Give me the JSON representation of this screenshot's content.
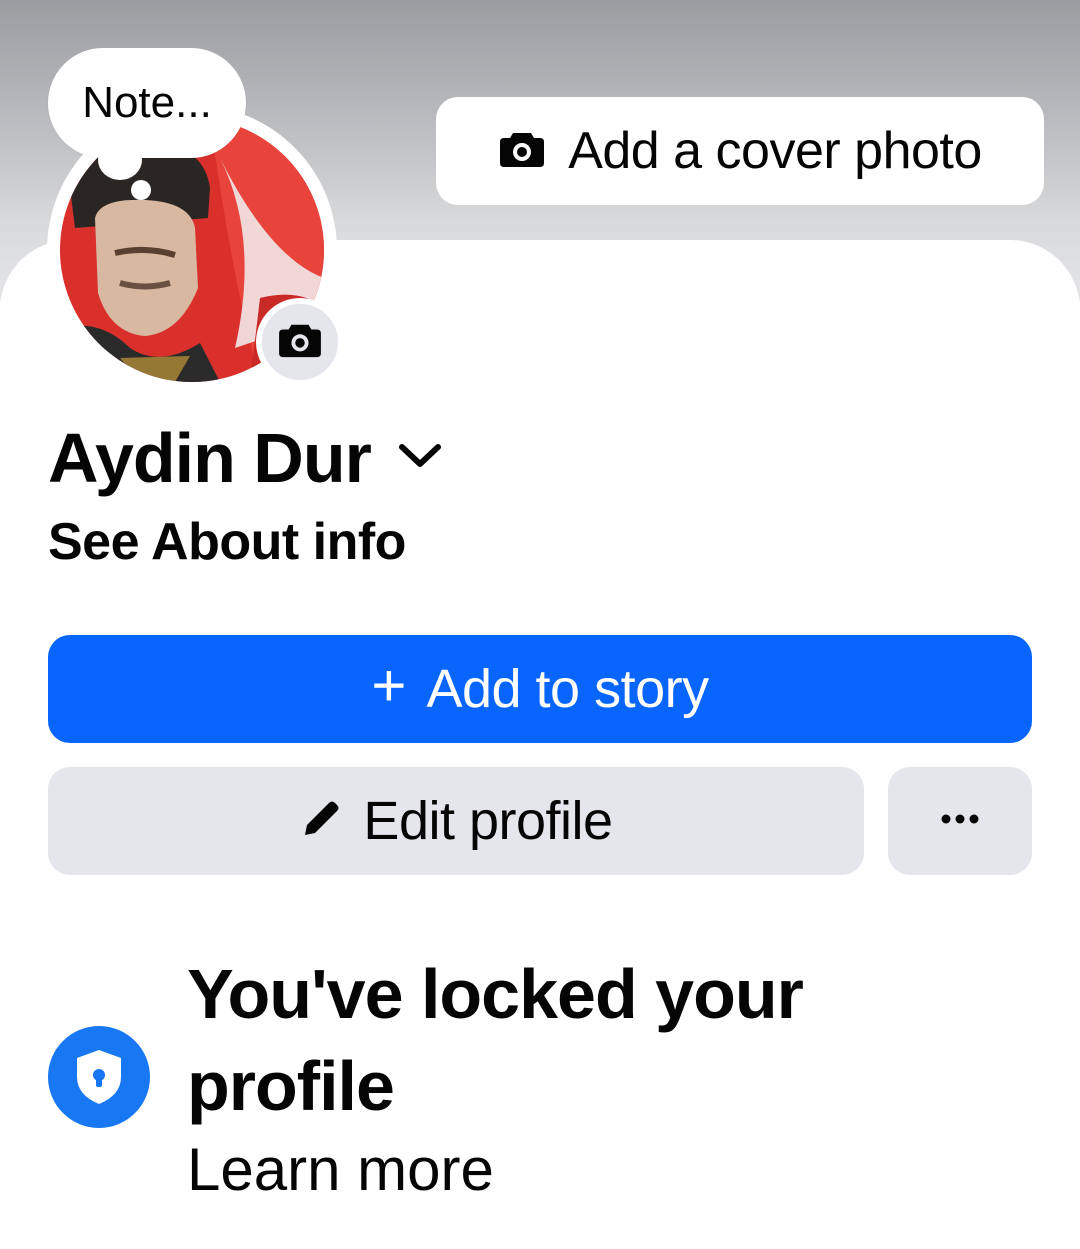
{
  "cover": {
    "add_cover_label": "Add a cover photo",
    "camera_icon": "camera-icon"
  },
  "note": {
    "placeholder": "Note..."
  },
  "avatar": {
    "description_icon": "profile-photo",
    "camera_icon": "camera-icon"
  },
  "profile": {
    "name": "Aydin Dur",
    "chevron_icon": "chevron-down-icon",
    "about_link": "See About info"
  },
  "actions": {
    "story_plus": "+",
    "story_label": "Add to story",
    "edit_label": "Edit profile",
    "edit_icon": "pencil-icon",
    "more_icon": "more-dots-icon"
  },
  "lock_notice": {
    "title": "You've locked your profile",
    "learn_more": "Learn more",
    "icon": "shield-lock-icon"
  },
  "colors": {
    "primary_blue": "#0866ff",
    "shield_blue": "#1877f2",
    "secondary_button": "#e4e6eb",
    "text": "#050505"
  }
}
